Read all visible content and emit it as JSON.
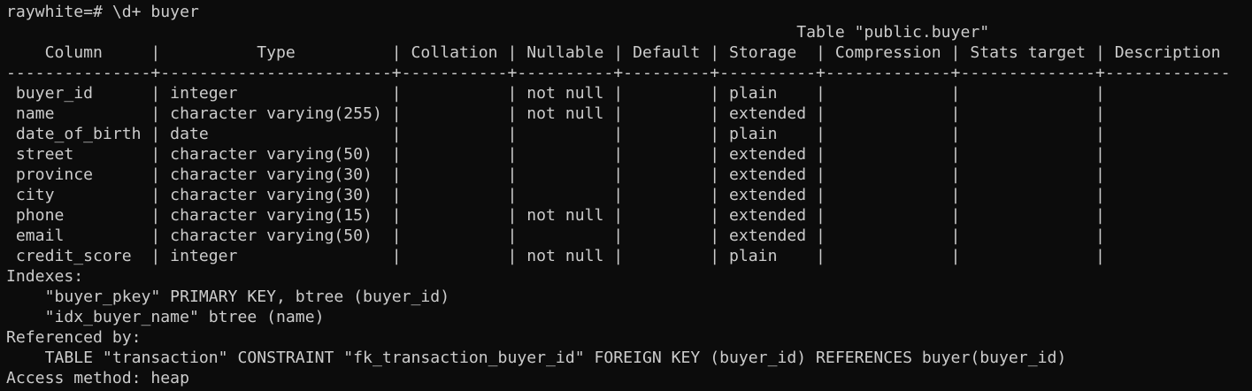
{
  "terminal": {
    "background": "#0c0c0c",
    "foreground": "#cccccc",
    "prompt_line": "raywhite=# \\d+ buyer",
    "table_title": "                                                                                  Table \"public.buyer\"",
    "header": "    Column     |          Type          | Collation | Nullable | Default | Storage  | Compression | Stats target | Description",
    "separator": "---------------+------------------------+-----------+----------+---------+----------+-------------+--------------+-------------",
    "rows": [
      " buyer_id      | integer                |           | not null |         | plain    |             |              |",
      " name          | character varying(255) |           | not null |         | extended |             |              |",
      " date_of_birth | date                   |           |          |         | plain    |             |              |",
      " street        | character varying(50)  |           |          |         | extended |             |              |",
      " province      | character varying(30)  |           |          |         | extended |             |              |",
      " city          | character varying(30)  |           |          |         | extended |             |              |",
      " phone         | character varying(15)  |           | not null |         | extended |             |              |",
      " email         | character varying(50)  |           |          |         | extended |             |              |",
      " credit_score  | integer                |           | not null |         | plain    |             |              |"
    ],
    "indexes_heading": "Indexes:",
    "indexes": [
      "    \"buyer_pkey\" PRIMARY KEY, btree (buyer_id)",
      "    \"idx_buyer_name\" btree (name)"
    ],
    "referenced_heading": "Referenced by:",
    "references": [
      "    TABLE \"transaction\" CONSTRAINT \"fk_transaction_buyer_id\" FOREIGN KEY (buyer_id) REFERENCES buyer(buyer_id)"
    ],
    "access_method": "Access method: heap"
  }
}
